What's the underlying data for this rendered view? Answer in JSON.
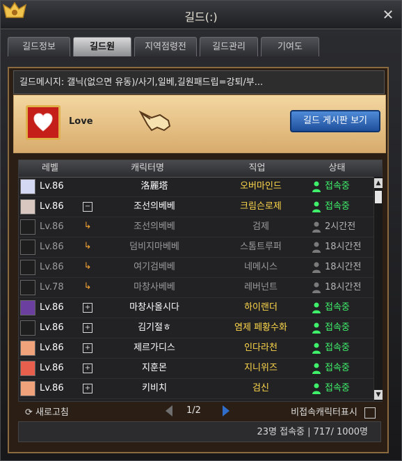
{
  "window": {
    "title": "길드(:)"
  },
  "tabs": [
    {
      "label": "길드정보"
    },
    {
      "label": "길드원"
    },
    {
      "label": "지역점령전"
    },
    {
      "label": "길드관리"
    },
    {
      "label": "기여도"
    }
  ],
  "guild": {
    "message": "길드메시지: 갤닉(없으면 유동)/사기,일베,길원패드립=강퇴/부...",
    "name": "Love",
    "board_button": "길드 게시판 보기"
  },
  "table": {
    "headers": [
      "레벨",
      "캐릭터명",
      "직업",
      "상태"
    ],
    "rows": [
      {
        "level": "Lv.86",
        "mark": "",
        "name": "洛麗塔",
        "job": "오버마인드",
        "status": "접속중",
        "online": true,
        "level_color": "white",
        "name_color": "white",
        "job_color": "yellow"
      },
      {
        "level": "Lv.86",
        "mark": "-",
        "name": "조선의베베",
        "job": "크림슨로제",
        "status": "접속중",
        "online": true,
        "level_color": "white",
        "name_color": "white",
        "job_color": "yellow"
      },
      {
        "level": "Lv.86",
        "mark": "arrow",
        "name": "조선의베베",
        "job": "검제",
        "status": "2시간전",
        "online": false,
        "level_color": "gray",
        "name_color": "gray",
        "job_color": "gray"
      },
      {
        "level": "Lv.86",
        "mark": "arrow",
        "name": "덤비지마베베",
        "job": "스톰트루퍼",
        "status": "18시간전",
        "online": false,
        "level_color": "gray",
        "name_color": "gray",
        "job_color": "gray"
      },
      {
        "level": "Lv.86",
        "mark": "arrow",
        "name": "여기검베베",
        "job": "네메시스",
        "status": "18시간전",
        "online": false,
        "level_color": "gray",
        "name_color": "gray",
        "job_color": "gray"
      },
      {
        "level": "Lv.78",
        "mark": "arrow",
        "name": "마창사베베",
        "job": "레버넌트",
        "status": "18시간전",
        "online": false,
        "level_color": "gray",
        "name_color": "gray",
        "job_color": "gray"
      },
      {
        "level": "Lv.86",
        "mark": "+",
        "name": "마창사올시다",
        "job": "하이랜더",
        "status": "접속중",
        "online": true,
        "level_color": "white",
        "name_color": "white",
        "job_color": "yellow"
      },
      {
        "level": "Lv.86",
        "mark": "+",
        "name": "김기절ㅎ",
        "job": "염제 페황수화",
        "status": "접속중",
        "online": true,
        "level_color": "white",
        "name_color": "white",
        "job_color": "yellow"
      },
      {
        "level": "Lv.86",
        "mark": "+",
        "name": "제르가디스",
        "job": "인다라천",
        "status": "접속중",
        "online": true,
        "level_color": "white",
        "name_color": "white",
        "job_color": "yellow"
      },
      {
        "level": "Lv.86",
        "mark": "+",
        "name": "지훈몬",
        "job": "지니위즈",
        "status": "접속중",
        "online": true,
        "level_color": "white",
        "name_color": "white",
        "job_color": "yellow"
      },
      {
        "level": "Lv.86",
        "mark": "+",
        "name": "키비치",
        "job": "검신",
        "status": "접속중",
        "online": true,
        "level_color": "white",
        "name_color": "white",
        "job_color": "yellow"
      }
    ]
  },
  "footer": {
    "refresh_label": "새로고침",
    "page": "1/2",
    "offline_toggle": "비접속캐릭터표시"
  },
  "status_bar": {
    "text": "23명 접속중 | 717/ 1000명"
  },
  "colors": {
    "online": "#3ff06a",
    "offline": "#9b9b9b",
    "job_online": "#ffd84a",
    "accent_blue": "#2f6dc8",
    "emblem_red": "#c51f1a"
  }
}
